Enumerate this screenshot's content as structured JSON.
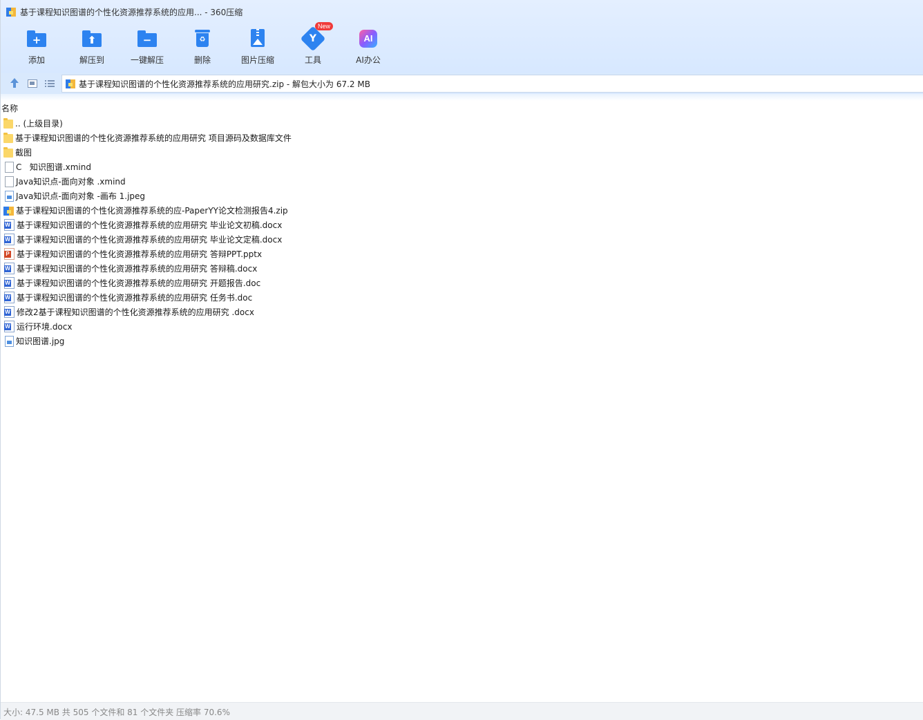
{
  "window": {
    "title": "基于课程知识图谱的个性化资源推荐系统的应用... - 360压缩"
  },
  "toolbar": {
    "items": [
      {
        "label": "添加",
        "icon": "add-folder-icon"
      },
      {
        "label": "解压到",
        "icon": "extract-to-icon"
      },
      {
        "label": "一键解压",
        "icon": "one-click-extract-icon"
      },
      {
        "label": "删除",
        "icon": "delete-bin-icon"
      },
      {
        "label": "图片压缩",
        "icon": "image-compress-icon"
      },
      {
        "label": "工具",
        "icon": "tools-icon",
        "badge": "New"
      },
      {
        "label": "AI办公",
        "icon": "ai-office-icon",
        "glyph": "AI"
      }
    ]
  },
  "addressbar": {
    "path": "基于课程知识图谱的个性化资源推荐系统的应用研究.zip - 解包大小为 67.2 MB"
  },
  "filelist": {
    "column_name": "名称",
    "files": [
      {
        "name": ".. (上级目录)",
        "type": "folder"
      },
      {
        "name": "基于课程知识图谱的个性化资源推荐系统的应用研究 项目源码及数据库文件",
        "type": "folder"
      },
      {
        "name": "截图",
        "type": "folder"
      },
      {
        "name": "C   知识图谱.xmind",
        "type": "file"
      },
      {
        "name": "Java知识点-面向对象 .xmind",
        "type": "file"
      },
      {
        "name": "Java知识点-面向对象 -画布 1.jpeg",
        "type": "image"
      },
      {
        "name": "基于课程知识图谱的个性化资源推荐系统的应-PaperYY论文检测报告4.zip",
        "type": "zip"
      },
      {
        "name": "基于课程知识图谱的个性化资源推荐系统的应用研究 毕业论文初稿.docx",
        "type": "word"
      },
      {
        "name": "基于课程知识图谱的个性化资源推荐系统的应用研究 毕业论文定稿.docx",
        "type": "word"
      },
      {
        "name": "基于课程知识图谱的个性化资源推荐系统的应用研究 答辩PPT.pptx",
        "type": "ppt"
      },
      {
        "name": "基于课程知识图谱的个性化资源推荐系统的应用研究 答辩稿.docx",
        "type": "word"
      },
      {
        "name": "基于课程知识图谱的个性化资源推荐系统的应用研究 开题报告.doc",
        "type": "word"
      },
      {
        "name": "基于课程知识图谱的个性化资源推荐系统的应用研究 任务书.doc",
        "type": "word"
      },
      {
        "name": "修改2基于课程知识图谱的个性化资源推荐系统的应用研究 .docx",
        "type": "word"
      },
      {
        "name": "运行环境.docx",
        "type": "word"
      },
      {
        "name": "知识图谱.jpg",
        "type": "image"
      }
    ]
  },
  "status": {
    "text": "大小: 47.5 MB 共 505 个文件和 81 个文件夹 压缩率 70.6%"
  }
}
